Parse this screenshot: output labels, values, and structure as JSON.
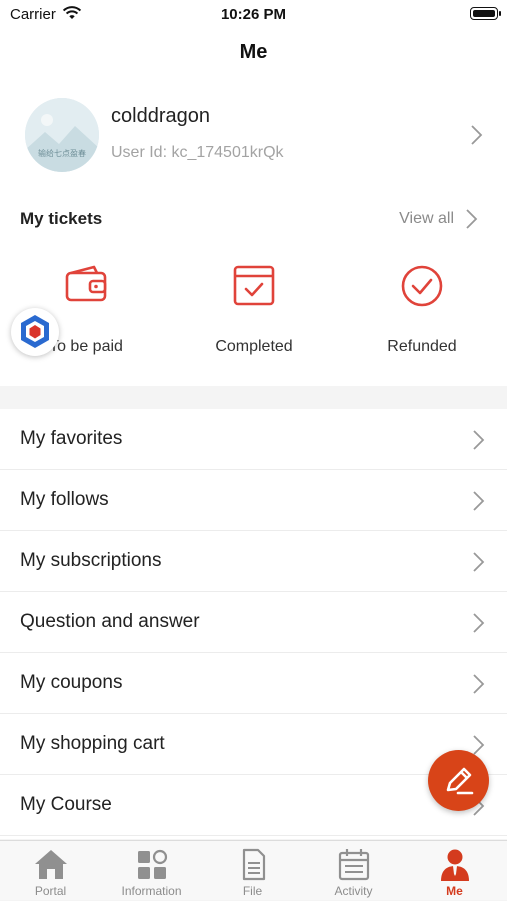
{
  "status_bar": {
    "carrier": "Carrier",
    "time": "10:26 PM"
  },
  "header": {
    "title": "Me"
  },
  "profile": {
    "username": "colddragon",
    "user_id": "User Id: kc_174501krQk",
    "avatar_text": "输给七点盈春"
  },
  "tickets": {
    "title": "My tickets",
    "view_all": "View all",
    "items": [
      {
        "label": "To be paid",
        "icon": "wallet-icon"
      },
      {
        "label": "Completed",
        "icon": "calendar-check-icon"
      },
      {
        "label": "Refunded",
        "icon": "check-circle-icon"
      }
    ]
  },
  "menu": {
    "items": [
      {
        "label": "My favorites"
      },
      {
        "label": "My follows"
      },
      {
        "label": "My subscriptions"
      },
      {
        "label": "Question and answer"
      },
      {
        "label": "My coupons"
      },
      {
        "label": "My shopping cart"
      },
      {
        "label": "My Course"
      }
    ]
  },
  "tab_bar": {
    "active": "Me",
    "items": [
      {
        "label": "Portal",
        "icon": "home-icon"
      },
      {
        "label": "Information",
        "icon": "grid-icon"
      },
      {
        "label": "File",
        "icon": "document-icon"
      },
      {
        "label": "Activity",
        "icon": "calendar-icon"
      },
      {
        "label": "Me",
        "icon": "person-icon"
      }
    ]
  },
  "colors": {
    "accent": "#d84418",
    "active_tab": "#d43b1e",
    "ticket_icon": "#e0433a"
  }
}
